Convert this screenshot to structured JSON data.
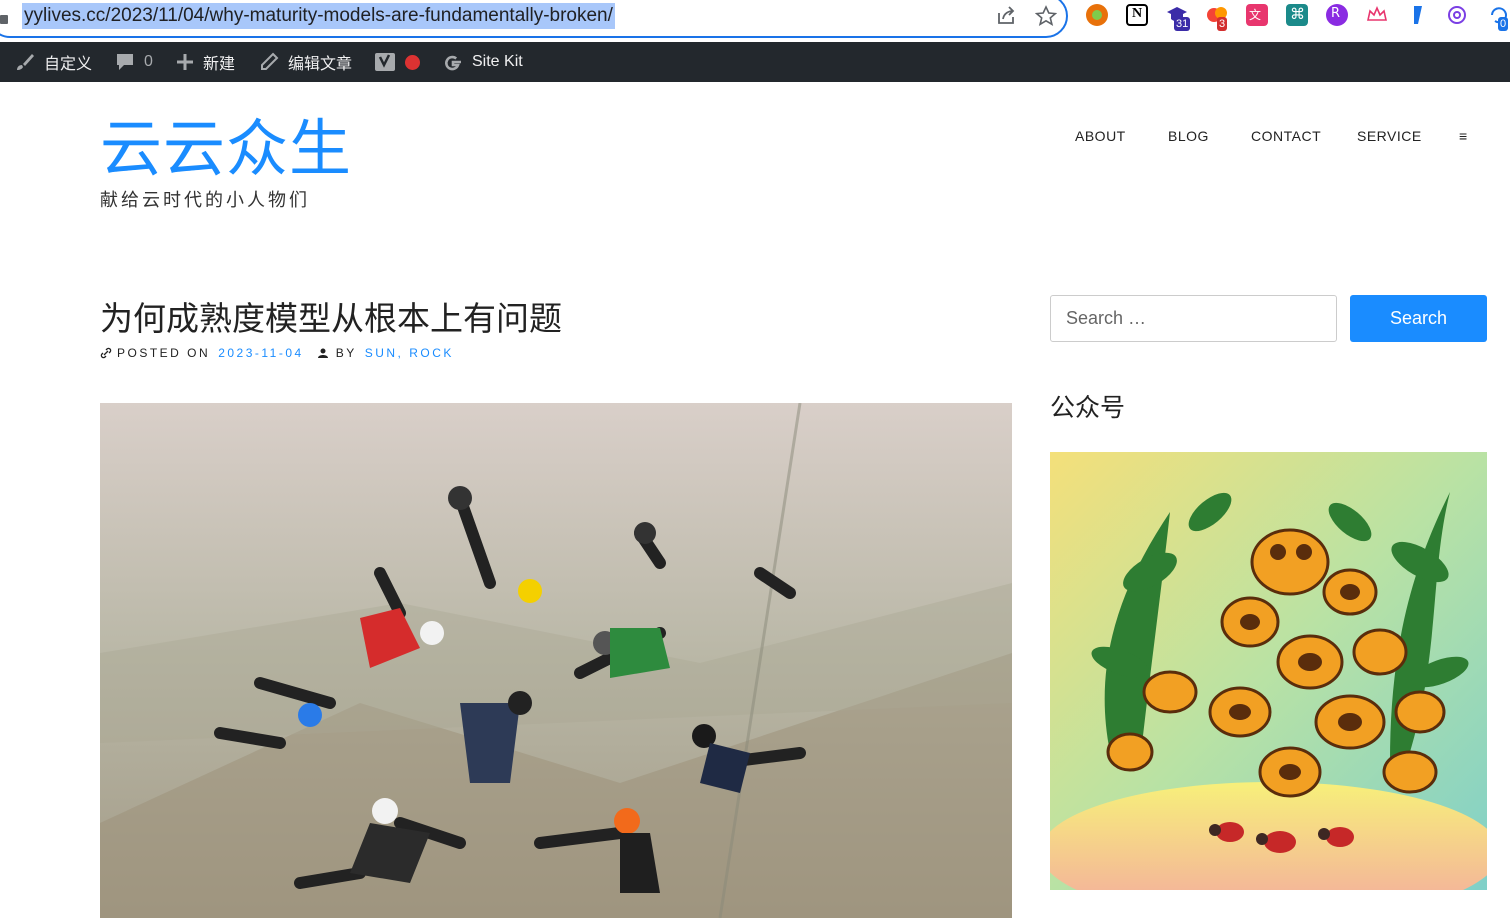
{
  "browser": {
    "url": "yylives.cc/2023/11/04/why-maturity-models-are-fundamentally-broken/",
    "extensions": [
      {
        "name": "extension-orange-circle",
        "color": "#e8710a"
      },
      {
        "name": "extension-notion",
        "color": "#000000"
      },
      {
        "name": "extension-graduation",
        "color": "#3b2ca8",
        "badge": "31"
      },
      {
        "name": "extension-red-blob",
        "color": "#f44336",
        "badge": "3"
      },
      {
        "name": "extension-translate",
        "color": "#e8366e"
      },
      {
        "name": "extension-teal",
        "color": "#1b8a8a"
      },
      {
        "name": "extension-purple",
        "color": "#8a2be2"
      },
      {
        "name": "extension-crown",
        "color": "#e8366e"
      },
      {
        "name": "extension-blue",
        "color": "#1a73e8"
      },
      {
        "name": "extension-openai",
        "color": "#7b3fe4"
      },
      {
        "name": "extension-refresh",
        "color": "#1a73e8",
        "badge": "0"
      }
    ]
  },
  "admin_bar": {
    "customize": "自定义",
    "comments_count": "0",
    "new": "新建",
    "edit_post": "编辑文章",
    "site_kit": "Site Kit",
    "accent": "#23282d"
  },
  "site": {
    "title": "云云众生",
    "description": "献给云时代的小人物们",
    "brand_color": "#1a8cff"
  },
  "nav": {
    "items": [
      "ABOUT",
      "BLOG",
      "CONTACT",
      "SERVICE"
    ],
    "menu_icon": "≡"
  },
  "post": {
    "title": "为何成熟度模型从根本上有问题",
    "posted_on_label": "POSTED ON",
    "date": "2023-11-04",
    "by_label": "BY",
    "author": "SUN, ROCK"
  },
  "sidebar": {
    "search_placeholder": "Search …",
    "search_button": "Search",
    "widget_title": "公众号"
  }
}
